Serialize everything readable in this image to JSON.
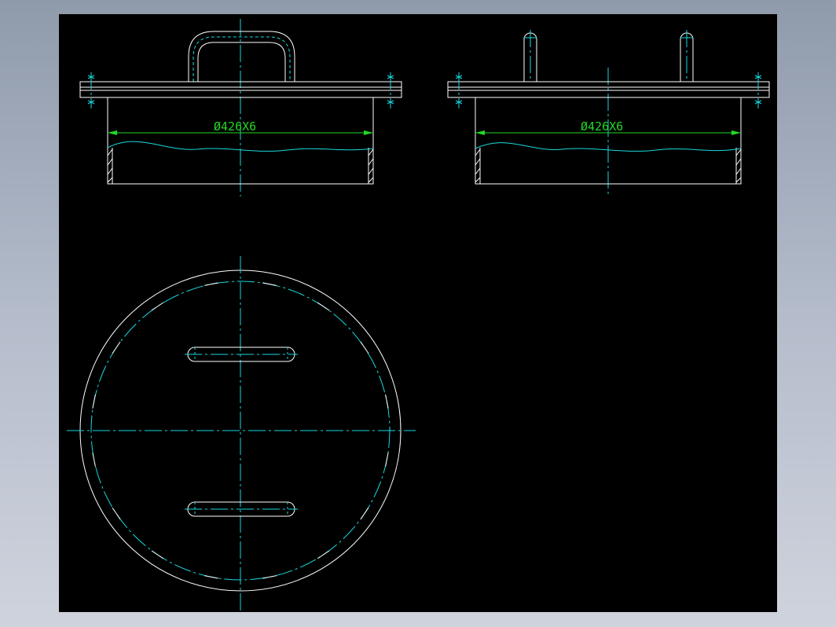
{
  "drawing": {
    "title": "",
    "views": {
      "front": {
        "dimension_label": "Ø426X6"
      },
      "side": {
        "dimension_label": "Ø426X6"
      },
      "plan": {}
    },
    "colors": {
      "geometry": "#ffffff",
      "centerline": "#19d9df",
      "dimension": "#22d922",
      "background": "#000000"
    }
  }
}
